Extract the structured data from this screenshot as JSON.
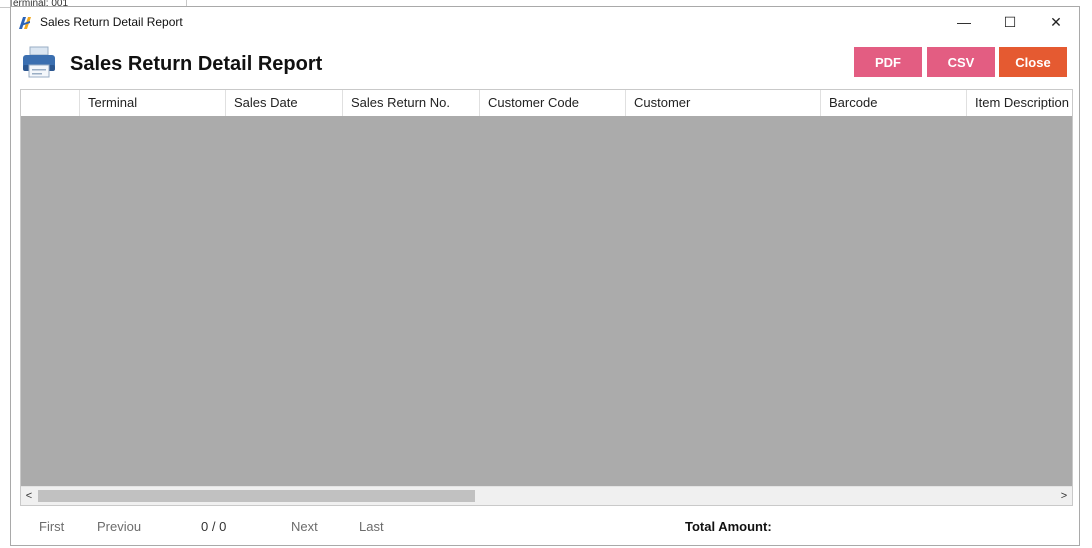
{
  "background_window": {
    "label": "Terminal: 001"
  },
  "window": {
    "title": "Sales Return Detail Report",
    "controls": {
      "minimize": "—",
      "maximize": "☐",
      "close": "✕"
    }
  },
  "header": {
    "title": "Sales Return Detail Report",
    "icon": "printer-icon"
  },
  "toolbar": {
    "pdf_label": "PDF",
    "csv_label": "CSV",
    "close_label": "Close",
    "colors": {
      "pdf": "#e35d82",
      "csv": "#e35d82",
      "close": "#e55a31"
    }
  },
  "grid": {
    "columns": [
      "",
      "Terminal",
      "Sales Date",
      "Sales Return No.",
      "Customer Code",
      "Customer",
      "Barcode",
      "Item Description"
    ],
    "rows": [],
    "body_color": "#ababab"
  },
  "scrollbar": {
    "left_arrow": "<",
    "right_arrow": ">"
  },
  "footer": {
    "first": "First",
    "previous": "Previou",
    "page_count": "0 / 0",
    "next": "Next",
    "last": "Last",
    "total_label": "Total Amount:"
  }
}
